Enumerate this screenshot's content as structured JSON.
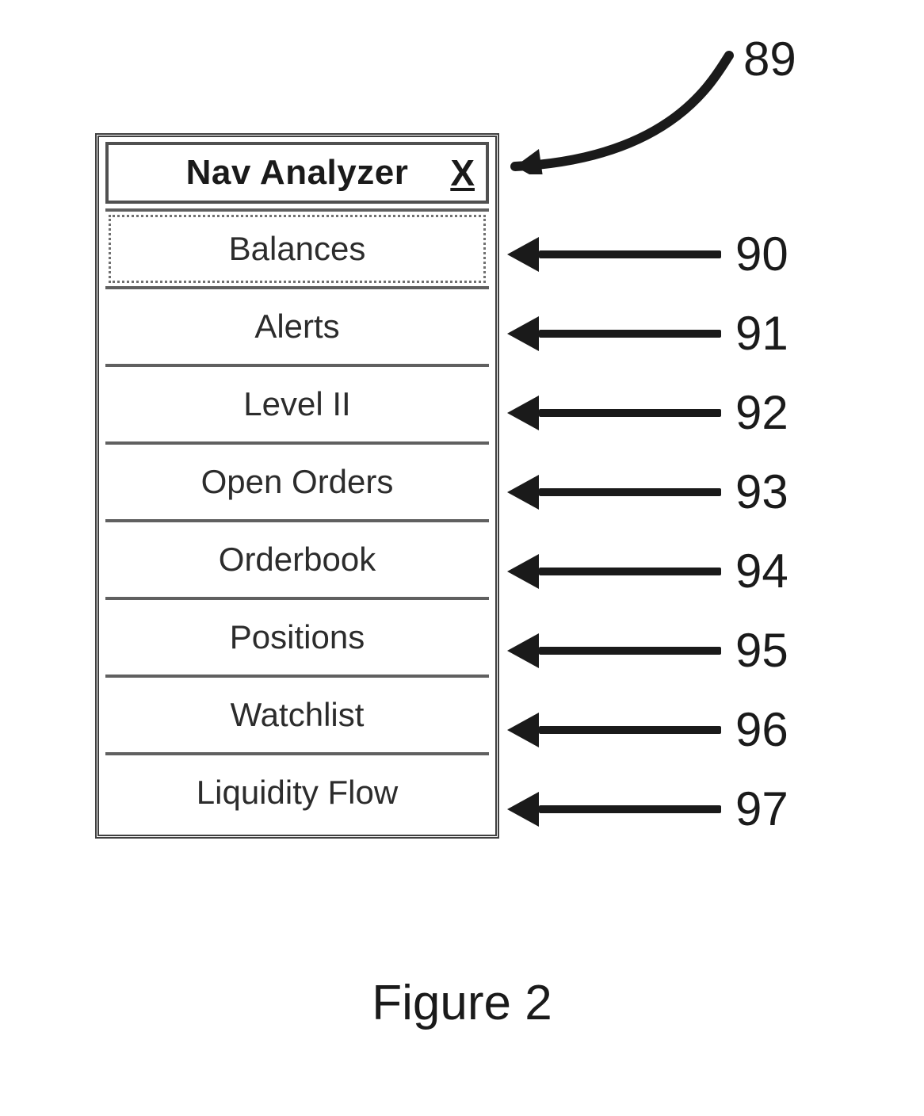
{
  "panel": {
    "title": "Nav Analyzer",
    "close_glyph": "X",
    "items": [
      {
        "label": "Balances"
      },
      {
        "label": "Alerts"
      },
      {
        "label": "Level II"
      },
      {
        "label": "Open Orders"
      },
      {
        "label": "Orderbook"
      },
      {
        "label": "Positions"
      },
      {
        "label": "Watchlist"
      },
      {
        "label": "Liquidity Flow"
      }
    ]
  },
  "callouts": {
    "header": "89",
    "items": [
      "90",
      "91",
      "92",
      "93",
      "94",
      "95",
      "96",
      "97"
    ]
  },
  "caption": "Figure 2"
}
